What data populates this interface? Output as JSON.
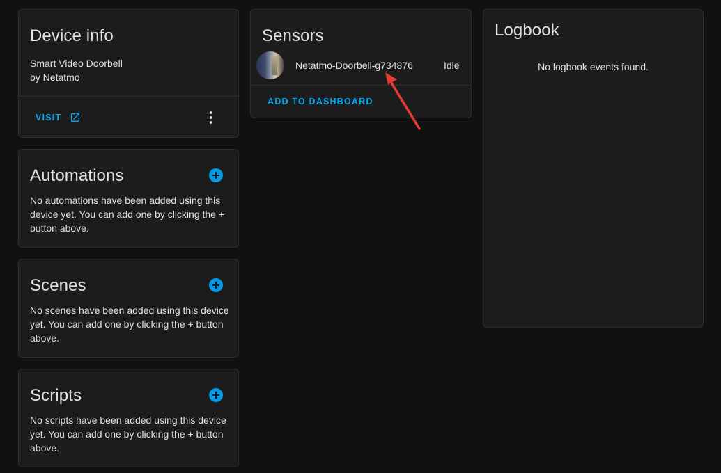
{
  "device_info": {
    "title": "Device info",
    "model": "Smart Video Doorbell",
    "manufacturer": "by Netatmo",
    "visit_label": "VISIT"
  },
  "automations": {
    "title": "Automations",
    "empty_text": "No automations have been added using this device yet. You can add one by clicking the + button above."
  },
  "scenes": {
    "title": "Scenes",
    "empty_text": "No scenes have been added using this device yet. You can add one by clicking the + button above."
  },
  "scripts": {
    "title": "Scripts",
    "empty_text": "No scripts have been added using this device yet. You can add one by clicking the + button above."
  },
  "sensors": {
    "title": "Sensors",
    "entity_name": "Netatmo-Doorbell-g734876",
    "entity_state": "Idle",
    "add_to_dashboard_label": "ADD TO DASHBOARD"
  },
  "logbook": {
    "title": "Logbook",
    "empty_text": "No logbook events found."
  },
  "colors": {
    "accent": "#03a9f4",
    "card_bg": "#1c1c1c",
    "page_bg": "#111111",
    "annotation_arrow": "#e53935"
  },
  "icons": {
    "visit": "open-in-new-icon",
    "menu": "more-vert-icon",
    "add": "plus-circle-icon"
  }
}
